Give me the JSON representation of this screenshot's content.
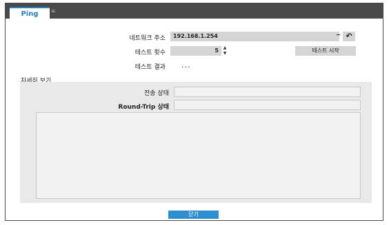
{
  "tabs": [
    {
      "label": "Ping",
      "active": true
    },
    {
      "label": "ㅌ",
      "active": false
    }
  ],
  "form": {
    "network_address_label": "네트워크 주소",
    "network_address_value": "192.168.1.254",
    "test_count_label": "테스트 횟수",
    "test_count_value": "5",
    "spin_up": "▲",
    "spin_down": "▼",
    "start_test_label": "테스트 시작",
    "back_icon": "↶",
    "test_result_label": "테스트 결과",
    "test_result_value": "..."
  },
  "details": {
    "title": "자세히 보기",
    "transmit_status_label": "전송 상태",
    "transmit_status_value": "",
    "round_trip_label": "Round-Trip 상태",
    "round_trip_value": "",
    "log_text": ""
  },
  "footer": {
    "close_label": "닫기"
  },
  "colors": {
    "accent": "#2d8fcf",
    "tab_bar": "#4a4a4a",
    "field_bg": "#d4d4d4",
    "panel_bg": "#e9e9e9"
  }
}
